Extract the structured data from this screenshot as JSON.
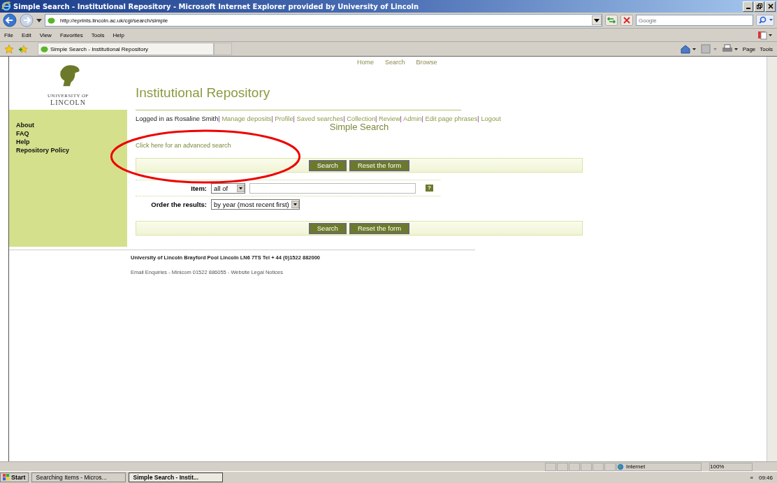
{
  "window": {
    "title": "Simple Search - Institutional Repository - Microsoft Internet Explorer provided by University of Lincoln"
  },
  "address_bar": {
    "value": "http://eprints.lincoln.ac.uk/cgi/search/simple"
  },
  "search_box": {
    "placeholder": "Google"
  },
  "menu": [
    "File",
    "Edit",
    "View",
    "Favorites",
    "Tools",
    "Help"
  ],
  "tabs": [
    {
      "label": "Simple Search - Institutional Repository",
      "selected": true
    }
  ],
  "command_bar": [
    "Page",
    "Tools"
  ],
  "page": {
    "top_nav": [
      "Home",
      "Search",
      "Browse"
    ],
    "logo": {
      "line_1": "UNIVERSITY OF",
      "line_2": "LINCOLN"
    },
    "site_title": "Institutional Repository",
    "sidebar": [
      "About",
      "FAQ",
      "Help",
      "Repository Policy"
    ],
    "login": {
      "text": "Logged in as Rosaline Smith",
      "separator": "|",
      "links": [
        "Manage deposits",
        "Profile",
        "Saved searches",
        "Collection",
        "Review",
        "Admin",
        "Edit page phrases",
        "Logout"
      ]
    },
    "heading": "Simple Search",
    "advanced_link": "Click here for an advanced search",
    "button_bars": [
      [
        "Search",
        "Reset the form"
      ],
      [
        "Search",
        "Reset the form"
      ]
    ],
    "form": {
      "item_label": "Item:",
      "item_mode": "all of",
      "help": "?",
      "order_label": "Order the results:",
      "order_value": "by year (most recent first)"
    },
    "footer": {
      "address": "University of Lincoln Brayford Pool Lincoln LN6 7TS Tel + 44 (0)1522 882000",
      "links": "Email Enquiries - Minicom 01522 886055 - Website Legal Notices"
    }
  },
  "status_bar": {
    "zone": "Internet",
    "zoom": "100%"
  },
  "taskbar": {
    "start": "Start",
    "tasks": [
      {
        "label": "Searching Items - Micros...",
        "selected": false
      },
      {
        "label": "Simple Search - Instit...",
        "selected": true
      }
    ],
    "expand": "«",
    "clock": "09:46"
  }
}
